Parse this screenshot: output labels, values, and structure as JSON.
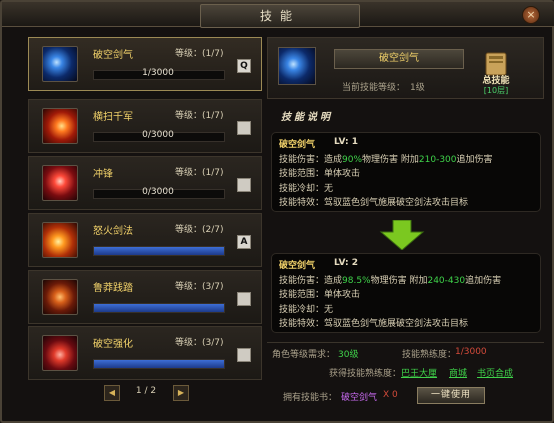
{
  "window": {
    "title": "技能",
    "close_label": "×"
  },
  "skills": [
    {
      "name": "破空剑气",
      "level_label": "等级：(1/7)",
      "progress_text": "1/3000",
      "progress": 0.0003,
      "hotkey": "Q",
      "active": true,
      "icon": "blue-slash-icon"
    },
    {
      "name": "横扫千军",
      "level_label": "等级：(1/7)",
      "progress_text": "0/3000",
      "progress": 0,
      "hotkey": "",
      "active": false,
      "icon": "fire-sweep-icon"
    },
    {
      "name": "冲锋",
      "level_label": "等级：(1/7)",
      "progress_text": "0/3000",
      "progress": 0,
      "hotkey": "",
      "active": false,
      "icon": "charge-icon"
    },
    {
      "name": "怒火剑法",
      "level_label": "等级：(2/7)",
      "progress_text": "",
      "progress": 1,
      "hotkey": "A",
      "active": false,
      "icon": "fire-sword-icon"
    },
    {
      "name": "鲁莽践踏",
      "level_label": "等级：(3/7)",
      "progress_text": "",
      "progress": 1,
      "hotkey": "",
      "active": false,
      "icon": "stomp-icon"
    },
    {
      "name": "破空强化",
      "level_label": "等级：(3/7)",
      "progress_text": "",
      "progress": 1,
      "hotkey": "",
      "active": false,
      "icon": "empower-icon"
    }
  ],
  "pager": {
    "prev": "◀",
    "text": "1 / 2",
    "next": "▶"
  },
  "detail": {
    "name": "破空剑气",
    "current_level_label": "当前技能等级：",
    "current_level_value": "1级",
    "book_label": "总技能",
    "book_sub": "[10层]",
    "desc_title": "技能说明"
  },
  "levels": [
    {
      "name": "破空剑气",
      "lv": "LV: 1",
      "dmg_prefix": "技能伤害：造成",
      "dmg_pct": "90%",
      "dmg_mid": "物理伤害 附加",
      "dmg_extra": "210-300",
      "dmg_suffix": "追加伤害",
      "range": "技能范围：单体攻击",
      "cooldown": "技能冷却：无",
      "effect": "技能特效：驾驭蓝色剑气施展破空剑法攻击目标"
    },
    {
      "name": "破空剑气",
      "lv": "LV: 2",
      "dmg_prefix": "技能伤害：造成",
      "dmg_pct": "98.5%",
      "dmg_mid": "物理伤害 附加",
      "dmg_extra": "240-430",
      "dmg_suffix": "追加伤害",
      "range": "技能范围：单体攻击",
      "cooldown": "技能冷却：无",
      "effect": "技能特效：驾驭蓝色剑气施展破空剑法攻击目标"
    }
  ],
  "requirements": {
    "role_level_label": "角色等级需求：",
    "role_level_value": "30级",
    "proficiency_label": "技能熟练度：",
    "proficiency_value": "1/3000"
  },
  "sources": {
    "label": "获得技能熟练度：",
    "links": [
      "巴王大厘",
      "商城",
      "书页合成"
    ]
  },
  "own": {
    "label": "拥有技能书：",
    "item": "破空剑气",
    "count": "X 0",
    "use_button": "一键使用"
  },
  "colors": {
    "gold": "#f2d26a",
    "green": "#3fd24a",
    "red": "#d24a3a",
    "bar_blue": "#3d6ed6"
  }
}
